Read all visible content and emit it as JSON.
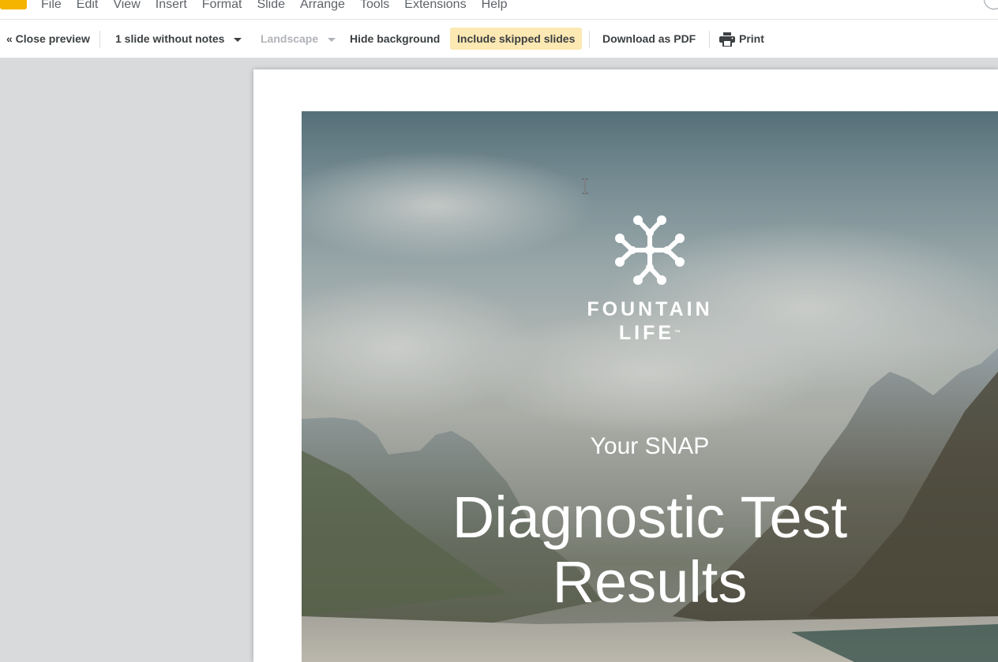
{
  "menu": {
    "items": [
      "File",
      "Edit",
      "View",
      "Insert",
      "Format",
      "Slide",
      "Arrange",
      "Tools",
      "Extensions",
      "Help"
    ]
  },
  "toolbar": {
    "close_preview": "« Close preview",
    "notes_option": "1 slide without notes",
    "orientation": "Landscape",
    "hide_background": "Hide background",
    "include_skipped": "Include skipped slides",
    "download_pdf": "Download as PDF",
    "print": "Print"
  },
  "slide": {
    "logo_line1": "FOUNTAIN",
    "logo_line2": "LIFE",
    "logo_tm": "™",
    "subtitle": "Your SNAP",
    "title_line1": "Diagnostic Test",
    "title_line2": "Results"
  },
  "colors": {
    "highlight": "#fce8b2",
    "app_accent": "#f4b400",
    "canvas": "#d9dadc"
  }
}
